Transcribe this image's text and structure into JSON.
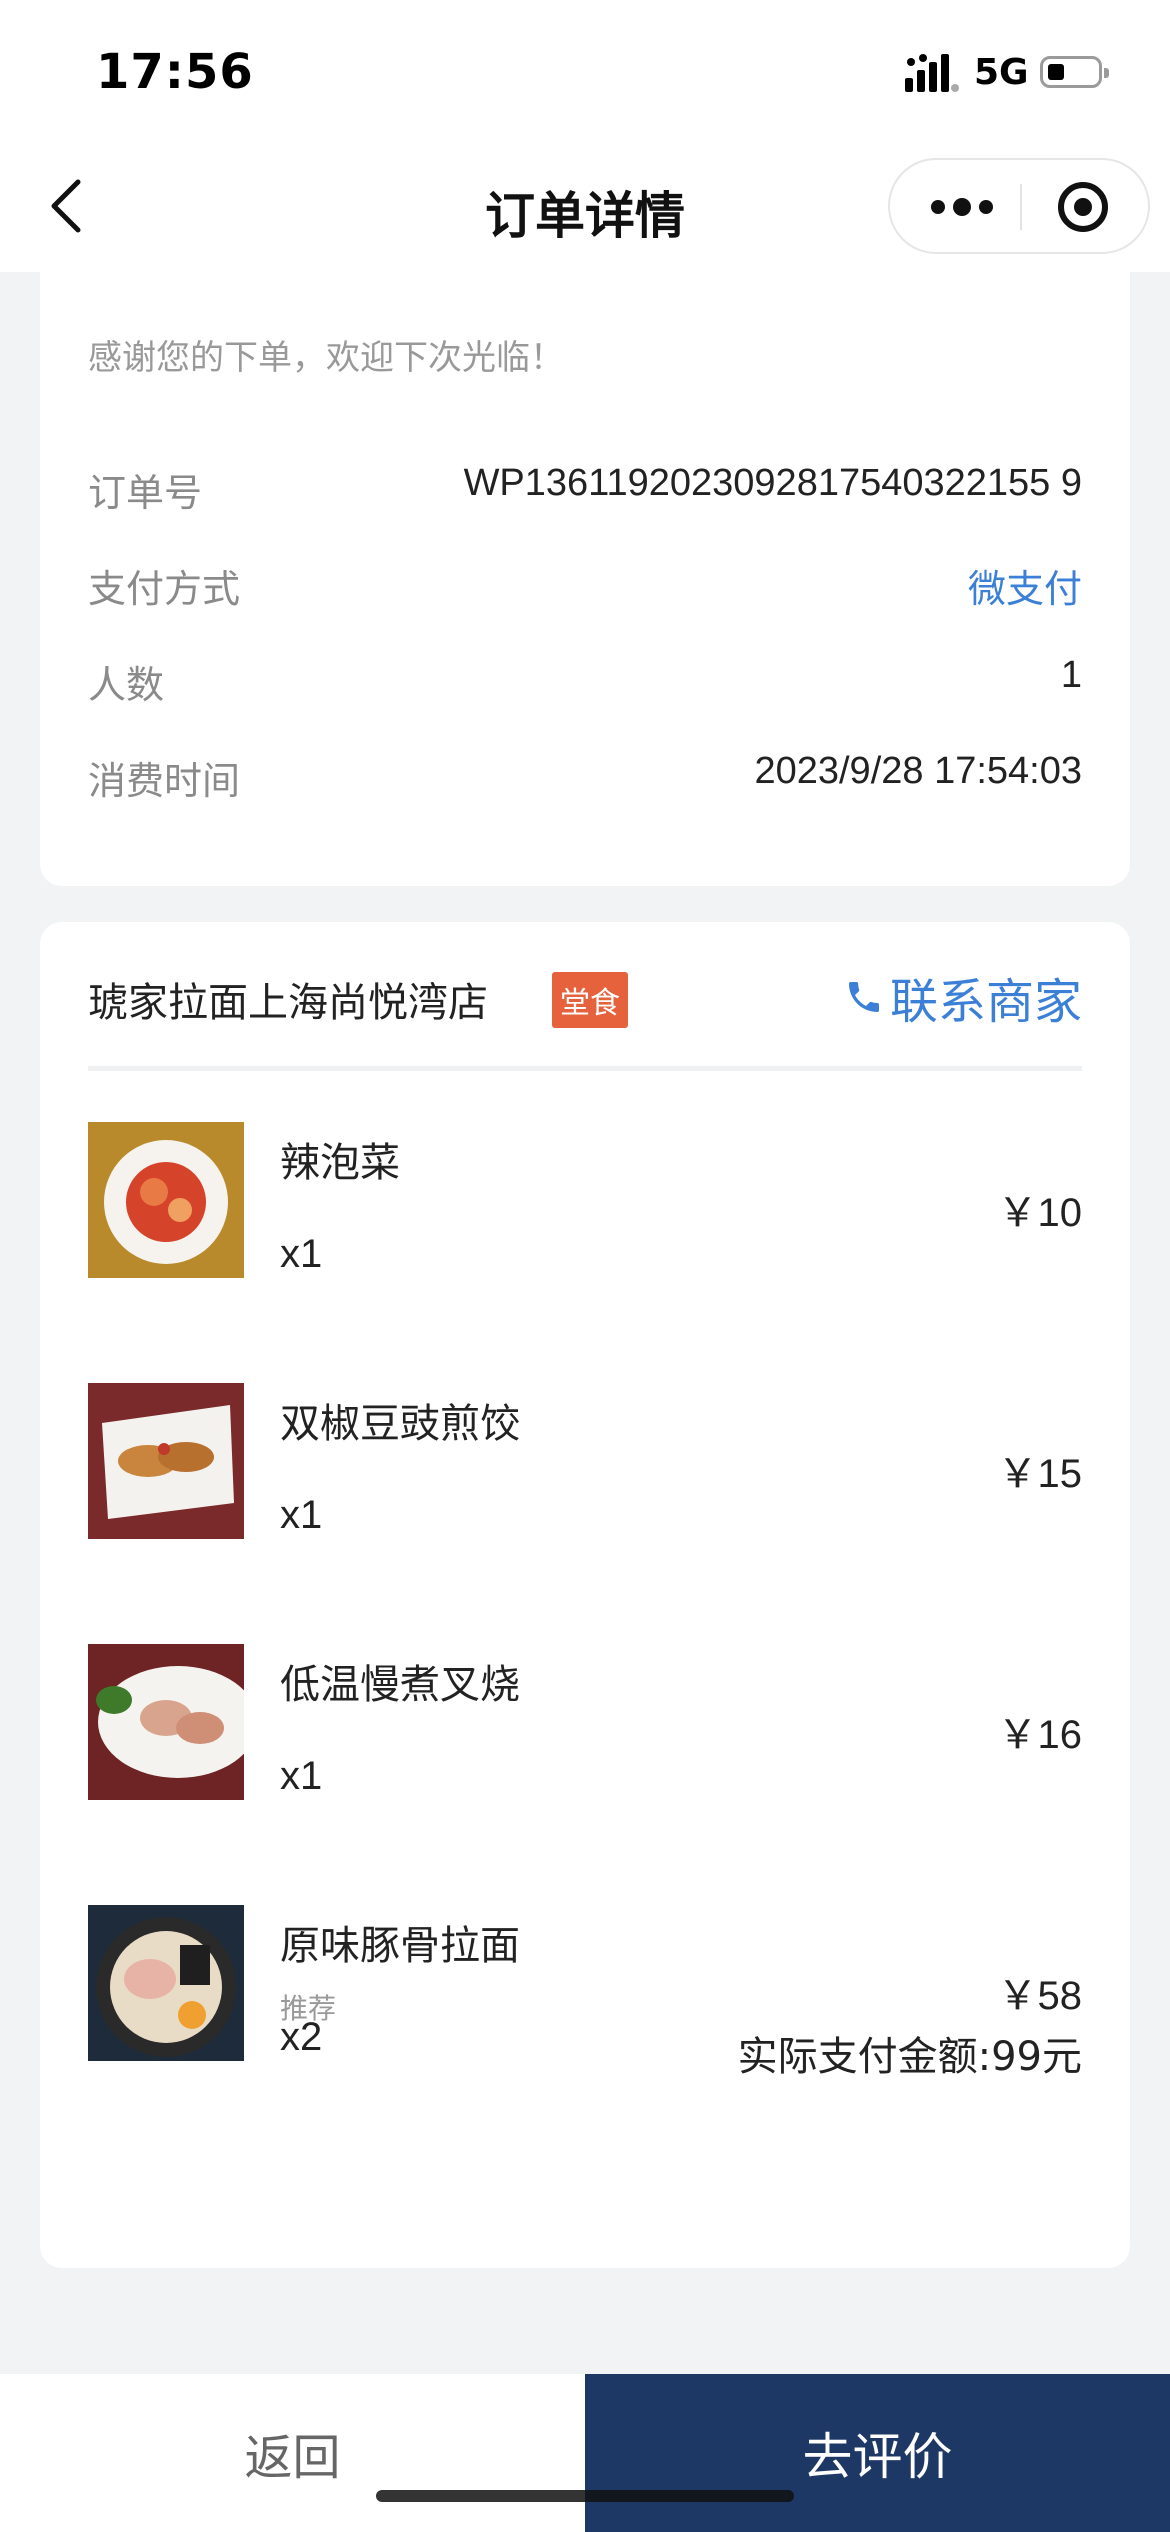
{
  "status": {
    "time": "17:56",
    "network": "5G"
  },
  "nav": {
    "title": "订单详情"
  },
  "order": {
    "thanks": "感谢您的下单，欢迎下次光临！",
    "rows": [
      {
        "label": "订单号",
        "value": "WP1361192023092817540322155 9"
      },
      {
        "label": "支付方式",
        "value": "微支付"
      },
      {
        "label": "人数",
        "value": "1"
      },
      {
        "label": "消费时间",
        "value": "2023/9/28 17:54:03"
      }
    ]
  },
  "store": {
    "name": "琥家拉面上海尚悦湾店",
    "tag": "堂食",
    "contact": "联系商家"
  },
  "items": [
    {
      "name": "辣泡菜",
      "note": "",
      "qty": "x1",
      "price": "￥10"
    },
    {
      "name": "双椒豆豉煎饺",
      "note": "",
      "qty": "x1",
      "price": "￥15"
    },
    {
      "name": "低温慢煮叉烧",
      "note": "",
      "qty": "x1",
      "price": "￥16"
    },
    {
      "name": "原味豚骨拉面",
      "note": "推荐",
      "qty": "x2",
      "price": "￥58"
    }
  ],
  "total": "实际支付金额:99元",
  "actions": {
    "back": "返回",
    "review": "去评价"
  },
  "colors": {
    "accent": "#3b80d6",
    "tag": "#e6623d",
    "primary_button": "#1e3866"
  }
}
